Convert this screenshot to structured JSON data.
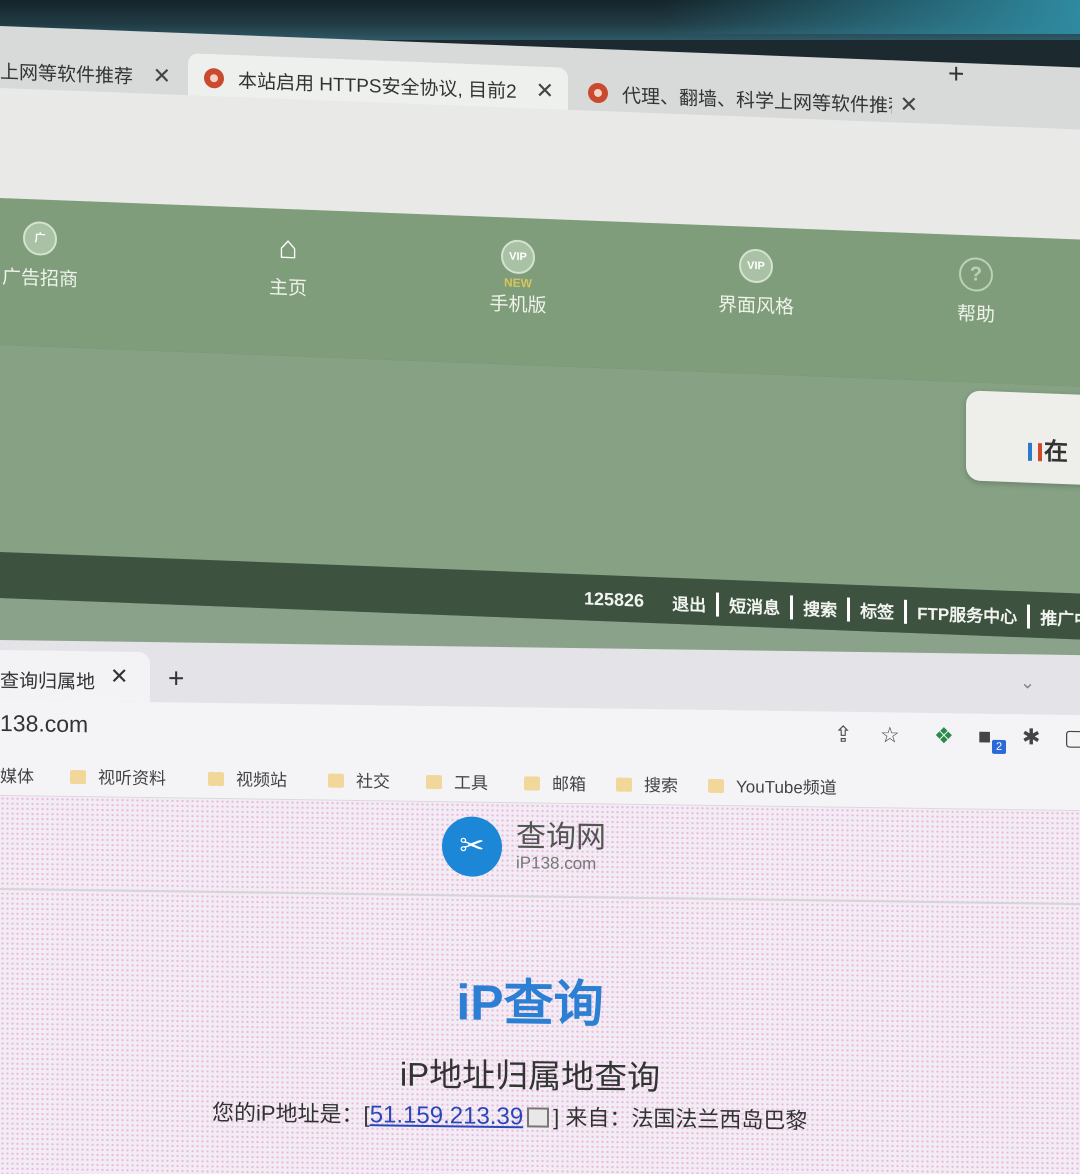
{
  "window1": {
    "tabs": [
      {
        "title": "上网等软件推荐",
        "close": "✕"
      },
      {
        "title": "本站启用 HTTPS安全协议, 目前2",
        "close": "✕"
      },
      {
        "title": "代理、翻墙、科学上网等软件推荐",
        "close": "✕"
      }
    ],
    "new_tab": "+",
    "nav": [
      {
        "label": "广告招商",
        "icon": "广"
      },
      {
        "label": "主页",
        "icon": "⌂"
      },
      {
        "label": "手机版",
        "icon": "VIP",
        "badge": "NEW"
      },
      {
        "label": "界面风格",
        "icon": "VIP"
      },
      {
        "label": "帮助",
        "icon": "?"
      }
    ],
    "online_box": "在",
    "status": {
      "user_number": "125826",
      "links": [
        "退出",
        "短消息",
        "搜索",
        "标签",
        "FTP服务中心",
        "推广中"
      ]
    }
  },
  "window2": {
    "tab_title": "查询归属地",
    "tab_close": "✕",
    "new_tab": "+",
    "url": "138.com",
    "extension_badge": "2",
    "bookmarks": [
      "媒体",
      "视听资料",
      "视频站",
      "社交",
      "工具",
      "邮箱",
      "搜索",
      "YouTube频道"
    ],
    "logo": {
      "name": "查询网",
      "domain": "iP138.com"
    },
    "heading": "iP查询",
    "subheading": "iP地址归属地查询",
    "ip_prefix": "您的iP地址是：[",
    "ip_address": "51.159.213.39",
    "ip_suffix": "] 来自：法国法兰西岛巴黎"
  },
  "colors": {
    "nav_green": "#7f9d7b",
    "status_dark": "#3d5340",
    "ip_blue": "#2d7fd4",
    "link_blue": "#2a47b8"
  }
}
